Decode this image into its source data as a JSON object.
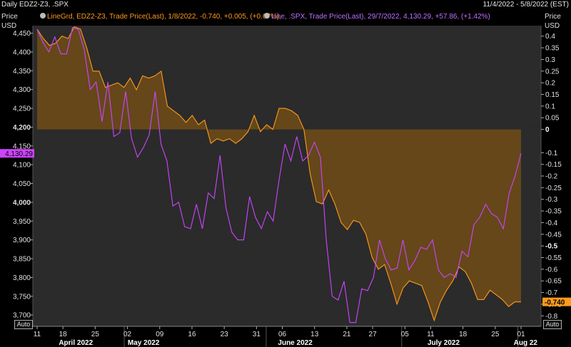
{
  "header": {
    "title": "Daily EDZ2-Z3, .SPX",
    "date_range": "11/4/2022 - 5/8/2022 (EST)"
  },
  "legend": {
    "series1": "LineGrd, EDZ2-Z3, Trade Price(Last), 1/8/2022, -0.740, +0.005, (+0.67%),",
    "series2": "Line, .SPX, Trade Price(Last), 29/7/2022, 4,130.29, +57.86, (+1.42%)"
  },
  "buttons": {
    "auto_left": "Auto",
    "auto_right": "Auto"
  },
  "colors": {
    "spx": "#cc44ff",
    "edz": "#ff9a1a",
    "fill": "#6b4a18",
    "grid": "#2a2a2a",
    "background": "#2b2b2b"
  },
  "chart_data": {
    "type": "line",
    "left_axis": {
      "title": "Price",
      "unit": "USD",
      "ticks": [
        "4,450",
        "4,400",
        "4,350",
        "4,300",
        "4,250",
        "4,200",
        "4,150",
        "4,100",
        "4,050",
        "4,000",
        "3,950",
        "3,900",
        "3,850",
        "3,800",
        "3,750",
        "3,700"
      ],
      "tick_values": [
        4450,
        4400,
        4350,
        4300,
        4250,
        4200,
        4150,
        4100,
        4050,
        4000,
        3950,
        3900,
        3850,
        3800,
        3750,
        3700
      ],
      "ylim": [
        3670,
        4470
      ],
      "last_value_label": "4,130.29",
      "last_value": 4130.29
    },
    "right_axis": {
      "title": "Price",
      "unit": "USD",
      "ticks": [
        "0.4",
        "0.35",
        "0.3",
        "0.25",
        "0.2",
        "0.15",
        "0.1",
        "0.05",
        "0",
        "-0.1",
        "-0.15",
        "-0.2",
        "-0.25",
        "-0.3",
        "-0.35",
        "-0.4",
        "-0.45",
        "-0.5",
        "-0.55",
        "-0.6",
        "-0.65",
        "-0.7",
        "-0.75",
        "-0.8"
      ],
      "tick_values": [
        0.4,
        0.35,
        0.3,
        0.25,
        0.2,
        0.15,
        0.1,
        0.05,
        0,
        -0.1,
        -0.15,
        -0.2,
        -0.25,
        -0.3,
        -0.35,
        -0.4,
        -0.45,
        -0.5,
        -0.55,
        -0.6,
        -0.65,
        -0.7,
        -0.75,
        -0.8
      ],
      "bold_ticks": [
        "0",
        "-0.5"
      ],
      "ylim": [
        -0.845,
        0.445
      ],
      "last_value_label": "-0.740",
      "last_value": -0.74
    },
    "x_axis": {
      "day_ticks": [
        "11",
        "18",
        "25",
        "02",
        "09",
        "16",
        "23",
        "31",
        "06",
        "13",
        "21",
        "27",
        "05",
        "11",
        "18",
        "25",
        "01"
      ],
      "day_tick_index": [
        0,
        4,
        9,
        14,
        19,
        24,
        29,
        34,
        38,
        43,
        48,
        52,
        57,
        61,
        66,
        71,
        75
      ],
      "month_labels": [
        "April 2022",
        "May 2022",
        "June 2022",
        "July 2022",
        "Aug 22"
      ],
      "month_label_index": [
        6,
        16.5,
        40,
        63,
        75.7
      ],
      "month_boundaries": [
        13.5,
        35.5,
        56.5,
        74.5
      ],
      "n_points": 76
    },
    "series": [
      {
        "name": ".SPX",
        "axis": "left",
        "values": [
          4460,
          4425,
          4400,
          4440,
          4395,
          4395,
          4465,
          4460,
          4405,
          4300,
          4320,
          4215,
          4320,
          4175,
          4185,
          4295,
          4170,
          4120,
          4145,
          4180,
          4295,
          4155,
          4110,
          3990,
          4000,
          3935,
          3930,
          3995,
          3930,
          4025,
          4010,
          4125,
          3985,
          3920,
          3900,
          3900,
          4015,
          3960,
          3930,
          3975,
          3950,
          4060,
          4155,
          4110,
          4175,
          4110,
          4125,
          4160,
          4120,
          3900,
          3750,
          3740,
          3790,
          3680,
          3680,
          3770,
          3765,
          3800,
          3900,
          3850,
          3820,
          3825,
          3900,
          3820,
          3845,
          3880,
          3875,
          3900,
          3820,
          3800,
          3810,
          3800,
          3870,
          3855,
          3940,
          3960,
          3995,
          3970,
          3960,
          3930,
          4025,
          4070,
          4130.29
        ]
      },
      {
        "name": "EDZ2-Z3",
        "axis": "right",
        "values": [
          0.43,
          0.39,
          0.36,
          0.37,
          0.4,
          0.39,
          0.44,
          0.43,
          0.35,
          0.25,
          0.25,
          0.18,
          0.19,
          0.2,
          0.18,
          0.22,
          0.17,
          0.23,
          0.22,
          0.23,
          0.25,
          0.1,
          0.08,
          0.06,
          0.03,
          0.06,
          0.02,
          0.04,
          -0.06,
          -0.04,
          -0.05,
          -0.04,
          -0.06,
          -0.04,
          -0.01,
          0.06,
          -0.01,
          0.02,
          0.0,
          0.09,
          0.09,
          0.08,
          0.06,
          0.0,
          -0.19,
          -0.31,
          -0.32,
          -0.26,
          -0.32,
          -0.4,
          -0.43,
          -0.39,
          -0.4,
          -0.45,
          -0.55,
          -0.6,
          -0.58,
          -0.66,
          -0.75,
          -0.68,
          -0.65,
          -0.66,
          -0.67,
          -0.74,
          -0.82,
          -0.74,
          -0.69,
          -0.65,
          -0.59,
          -0.61,
          -0.66,
          -0.73,
          -0.73,
          -0.69,
          -0.71,
          -0.73,
          -0.76,
          -0.74,
          -0.74
        ]
      }
    ]
  }
}
